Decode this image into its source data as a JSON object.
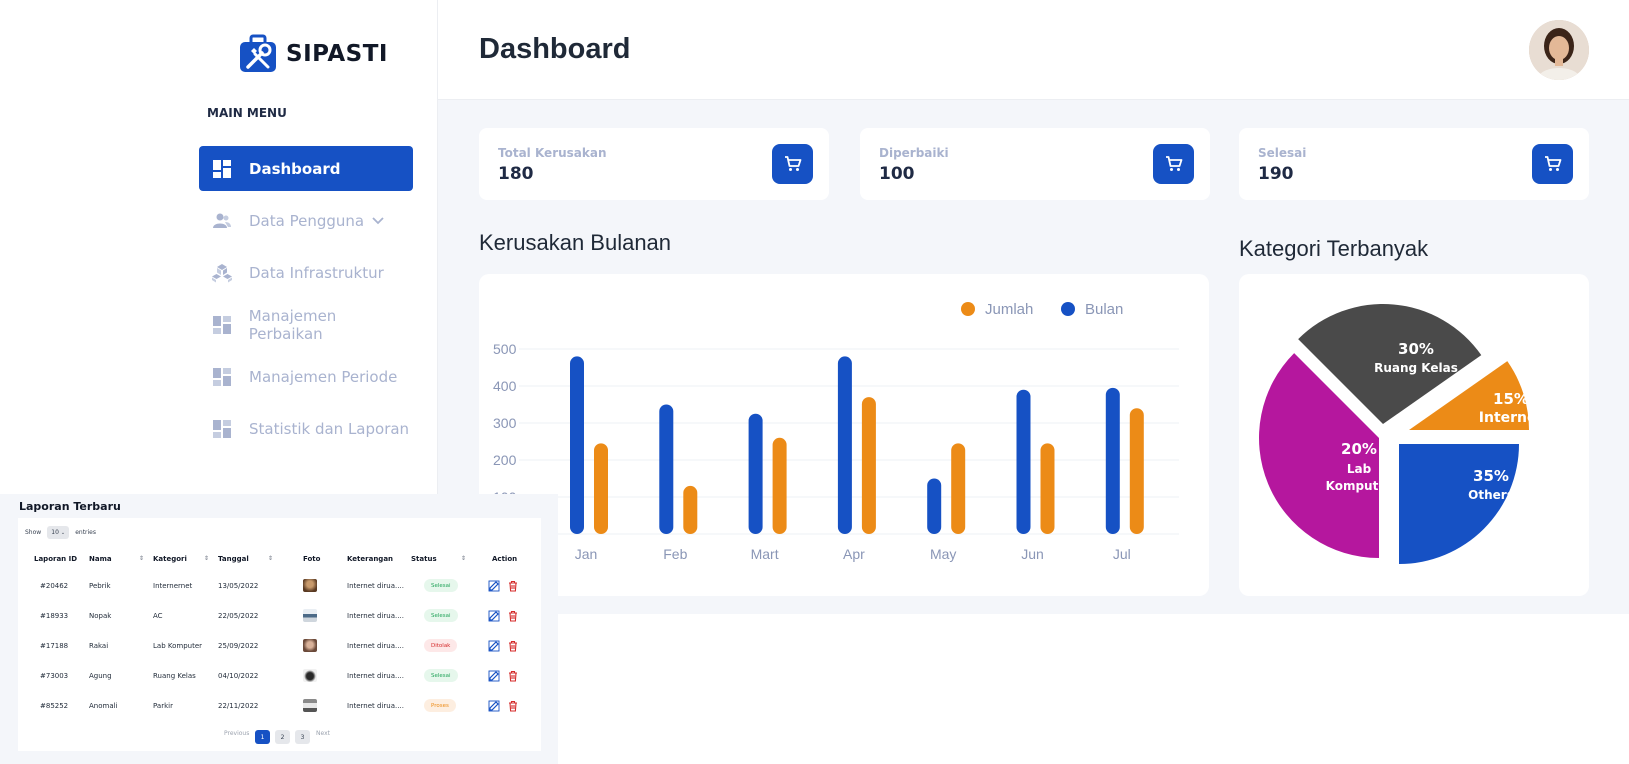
{
  "app": {
    "name": "SIPASTI",
    "brand_color": "#1651c4"
  },
  "sidebar": {
    "menu_label": "MAIN MENU",
    "items": [
      {
        "label": "Dashboard",
        "icon": "dashboard-icon",
        "active": true
      },
      {
        "label": "Data Pengguna",
        "icon": "users-icon",
        "active": false
      },
      {
        "label": "Data Infrastruktur",
        "icon": "cubes-icon",
        "active": false
      },
      {
        "label": "Manajemen Perbaikan",
        "icon": "dashboard-icon",
        "active": false
      },
      {
        "label": "Manajemen Periode",
        "icon": "dashboard-icon",
        "active": false
      },
      {
        "label": "Statistik dan Laporan",
        "icon": "dashboard-icon",
        "active": false
      }
    ]
  },
  "header": {
    "title": "Dashboard"
  },
  "stats": [
    {
      "label": "Total Kerusakan",
      "value": "180",
      "icon": "cart-icon"
    },
    {
      "label": "Diperbaiki",
      "value": "100",
      "icon": "cart-icon"
    },
    {
      "label": "Selesai",
      "value": "190",
      "icon": "cart-icon"
    }
  ],
  "bar_section": {
    "title": "Kerusakan Bulanan"
  },
  "pie_section": {
    "title": "Kategori Terbanyak"
  },
  "chart_data": [
    {
      "type": "bar",
      "categories": [
        "Jan",
        "Feb",
        "Mart",
        "Apr",
        "May",
        "Jun",
        "Jul"
      ],
      "series": [
        {
          "name": "Bulan",
          "color": "#1651c4",
          "values": [
            480,
            350,
            325,
            480,
            150,
            390,
            395
          ]
        },
        {
          "name": "Jumlah",
          "color": "#ec8b17",
          "values": [
            245,
            130,
            260,
            370,
            245,
            245,
            340
          ]
        }
      ],
      "legend": [
        "Jumlah",
        "Bulan"
      ],
      "legend_position": "top-right",
      "y_ticks": [
        "500",
        "400",
        "300",
        "200",
        "100"
      ],
      "ylim": [
        0,
        500
      ],
      "grid": true
    },
    {
      "type": "pie",
      "slices": [
        {
          "pct": "30%",
          "label": "Ruang Kelas",
          "value": 30,
          "color": "#4a4a4a"
        },
        {
          "pct": "15%",
          "label": "Internet",
          "value": 15,
          "color": "#ec8b17"
        },
        {
          "pct": "35%",
          "label": "Others",
          "value": 35,
          "color": "#1651c4"
        },
        {
          "pct": "20%",
          "label": "Lab Komputer",
          "value": 20,
          "color": "#b5179e"
        }
      ]
    }
  ],
  "table": {
    "title": "Laporan Terbaru",
    "show_label": "Show",
    "show_value": "10",
    "entries_label": "entries",
    "columns": [
      "Laporan ID",
      "Nama",
      "Kategori",
      "Tanggal",
      "Foto",
      "Keterangan",
      "Status",
      "Action"
    ],
    "rows": [
      {
        "id": "#20462",
        "nama": "Pebrik",
        "kategori": "Internernet",
        "tanggal": "13/05/2022",
        "keterangan": "Internet dirua....",
        "status": "Selesai",
        "status_type": "done"
      },
      {
        "id": "#18933",
        "nama": "Nopak",
        "kategori": "AC",
        "tanggal": "22/05/2022",
        "keterangan": "Internet dirua....",
        "status": "Selesai",
        "status_type": "done"
      },
      {
        "id": "#17188",
        "nama": "Rakai",
        "kategori": "Lab Komputer",
        "tanggal": "25/09/2022",
        "keterangan": "Internet dirua....",
        "status": "Ditolak",
        "status_type": "rejected"
      },
      {
        "id": "#73003",
        "nama": "Agung",
        "kategori": "Ruang Kelas",
        "tanggal": "04/10/2022",
        "keterangan": "Internet dirua....",
        "status": "Selesai",
        "status_type": "done"
      },
      {
        "id": "#85252",
        "nama": "Anomali",
        "kategori": "Parkir",
        "tanggal": "22/11/2022",
        "keterangan": "Internet dirua....",
        "status": "Proses",
        "status_type": "process"
      }
    ],
    "pagination": {
      "prev": "Previous",
      "pages": [
        "1",
        "2",
        "3"
      ],
      "active": "1",
      "next": "Next"
    }
  }
}
